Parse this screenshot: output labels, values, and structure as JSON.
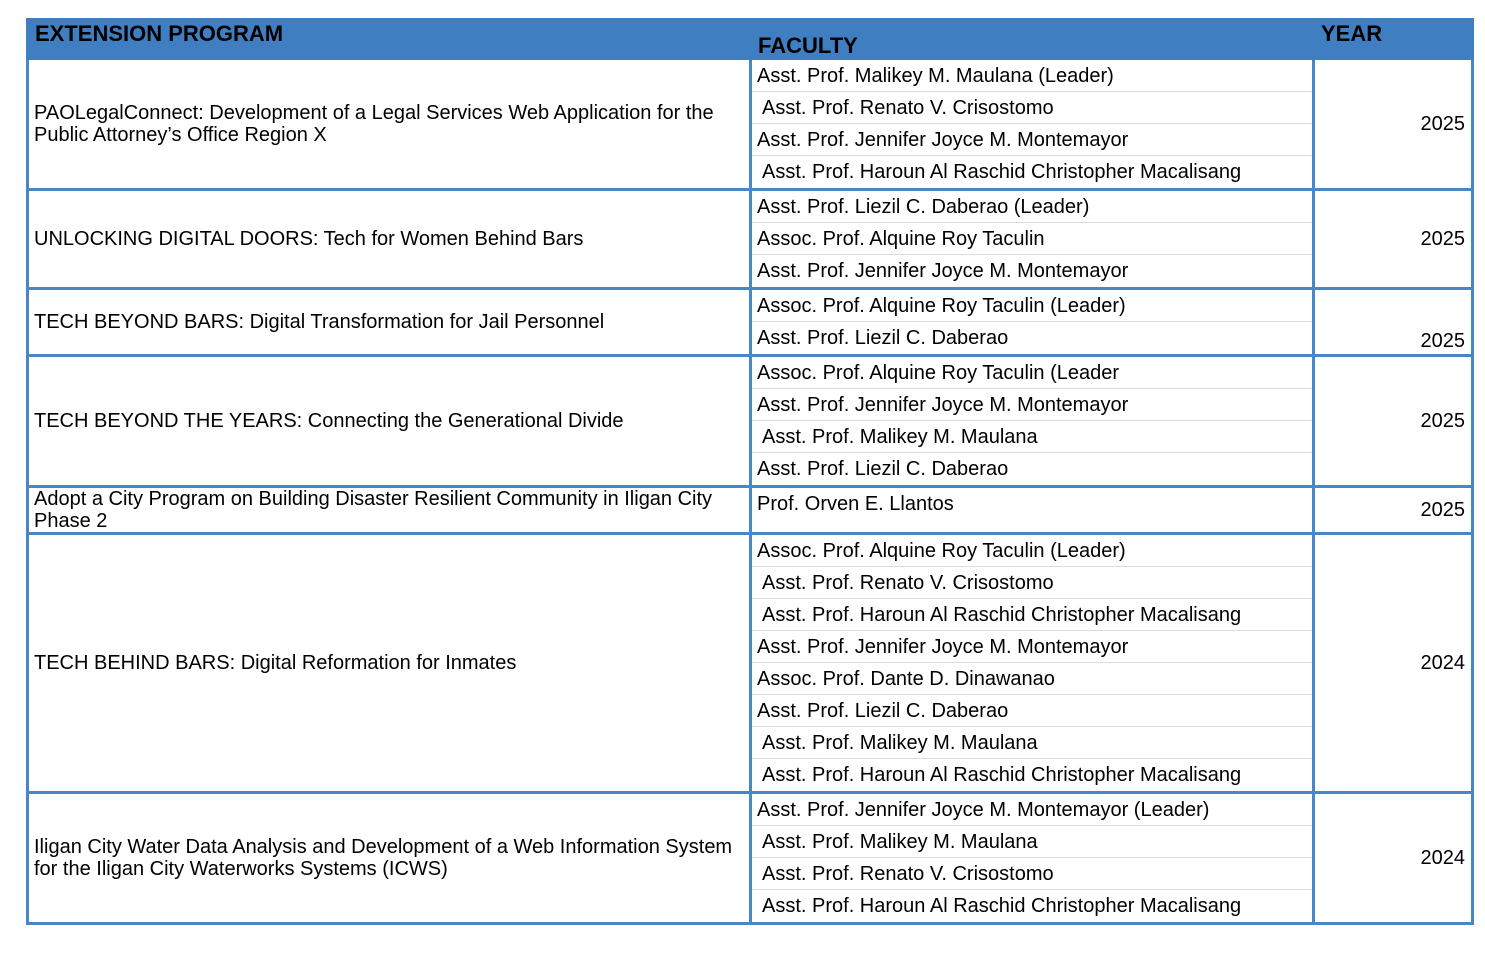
{
  "headers": {
    "program": "EXTENSION PROGRAM",
    "faculty": "FACULTY",
    "year": "YEAR"
  },
  "rows": [
    {
      "program": "PAOLegalConnect: Development of a Legal Services Web Application for the Public Attorney’s Office Region X",
      "faculty": [
        "Asst. Prof. Malikey M. Maulana (Leader)",
        "Asst. Prof. Renato V. Crisostomo",
        "Asst. Prof. Jennifer Joyce M. Montemayor",
        "Asst. Prof. Haroun Al Raschid Christopher Macalisang"
      ],
      "year": "2025"
    },
    {
      "program": "UNLOCKING DIGITAL DOORS: Tech for Women Behind Bars",
      "faculty": [
        "Asst. Prof. Liezil C. Daberao (Leader)",
        "Assoc. Prof. Alquine Roy Taculin",
        "Asst. Prof. Jennifer Joyce M. Montemayor"
      ],
      "year": "2025"
    },
    {
      "program": "TECH BEYOND BARS: Digital Transformation for Jail Personnel",
      "faculty": [
        "Assoc. Prof. Alquine Roy Taculin (Leader)",
        "Asst. Prof. Liezil C. Daberao"
      ],
      "year": "2025"
    },
    {
      "program": "TECH BEYOND THE YEARS: Connecting the Generational Divide",
      "faculty": [
        "Assoc. Prof. Alquine Roy Taculin (Leader",
        "Asst. Prof. Jennifer Joyce M. Montemayor",
        "Asst. Prof. Malikey M. Maulana",
        "Asst. Prof. Liezil C. Daberao"
      ],
      "year": "2025"
    },
    {
      "program": "Adopt a City Program on Building Disaster Resilient Community in Iligan City Phase 2",
      "faculty": [
        "Prof. Orven E. Llantos"
      ],
      "year": "2025"
    },
    {
      "program": "TECH BEHIND BARS: Digital Reformation for Inmates",
      "faculty": [
        "Assoc. Prof. Alquine Roy Taculin (Leader)",
        "Asst. Prof. Renato V. Crisostomo",
        "Asst. Prof. Haroun Al Raschid Christopher Macalisang",
        "Asst. Prof. Jennifer Joyce M. Montemayor",
        "Assoc. Prof. Dante D. Dinawanao",
        "Asst. Prof. Liezil C. Daberao",
        "Asst. Prof. Malikey M. Maulana",
        "Asst. Prof. Haroun Al Raschid Christopher Macalisang"
      ],
      "year": "2024"
    },
    {
      "program": "Iligan City Water Data Analysis and Development of a Web Information System for the Iligan City Waterworks Systems (ICWS)",
      "faculty": [
        "Asst. Prof. Jennifer Joyce M. Montemayor (Leader)",
        "Asst. Prof. Malikey M. Maulana",
        "Asst. Prof. Renato V. Crisostomo",
        "Asst. Prof. Haroun Al Raschid Christopher Macalisang"
      ],
      "year": "2024"
    }
  ]
}
